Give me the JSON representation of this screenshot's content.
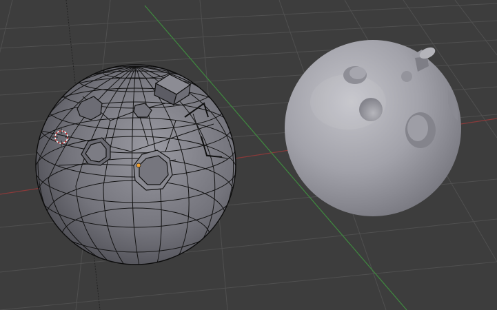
{
  "scene": {
    "background_color": "#3d3d3d",
    "grid_color": "#4f4f4f",
    "x_axis_color": "#8a3a3a",
    "y_axis_color": "#3f8a3f",
    "wire_color": "#111111",
    "mesh_fill_color": "#7d7d84",
    "smooth_fill_color": "#a8a8ae"
  },
  "objects": [
    {
      "name": "wireframe-sphere",
      "display": "wireframe",
      "features": [
        "extruded-cube",
        "crater",
        "crater",
        "crater",
        "crater",
        "seam"
      ]
    },
    {
      "name": "smooth-sphere",
      "display": "smooth-shaded",
      "features": [
        "cylinder",
        "crater",
        "crater",
        "crater",
        "crater",
        "crater"
      ]
    }
  ],
  "markers": {
    "cursor_icon": "3d-cursor-icon",
    "origin_icon": "object-origin-icon",
    "origin_color": "#f0a030",
    "cursor_colors": [
      "#cc2222",
      "#ffffff"
    ]
  }
}
